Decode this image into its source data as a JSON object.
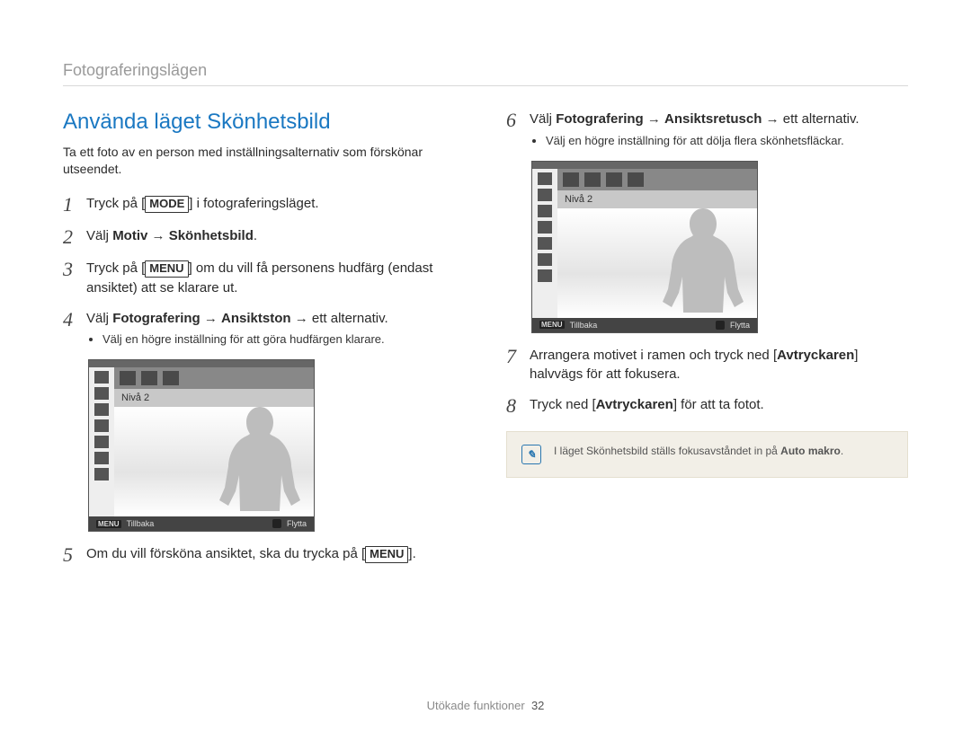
{
  "section_label": "Fotograferingslägen",
  "title": "Använda läget Skönhetsbild",
  "intro": "Ta ett foto av en person med inställningsalternativ som förskönar utseendet.",
  "keys": {
    "mode": "MODE",
    "menu": "MENU"
  },
  "steps_left": {
    "s1_a": "Tryck på [",
    "s1_b": "] i fotograferingsläget.",
    "s2_a": "Välj ",
    "s2_b": "Motiv",
    "s2_c": "Skönhetsbild",
    "s2_d": ".",
    "s3_a": "Tryck på [",
    "s3_b": "] om du vill få personens hudfärg (endast ansiktet) att se klarare ut.",
    "s4_a": "Välj ",
    "s4_b": "Fotografering",
    "s4_c": "Ansiktston",
    "s4_d": " → ett alternativ.",
    "s4_sub": "Välj en högre inställning för att göra hudfärgen klarare.",
    "s5_a": "Om du vill försköna ansiktet, ska du trycka på [",
    "s5_b": "]."
  },
  "steps_right": {
    "s6_a": "Välj ",
    "s6_b": "Fotografering",
    "s6_c": "Ansiktsretusch",
    "s6_d": " → ett alternativ.",
    "s6_sub": "Välj en högre inställning för att dölja flera skönhetsfläckar.",
    "s7_a": "Arrangera motivet i ramen och tryck ned [",
    "s7_b": "Avtryckaren",
    "s7_c": "] halvvägs för att fokusera.",
    "s8_a": "Tryck ned [",
    "s8_b": "Avtryckaren",
    "s8_c": "] för att ta fotot."
  },
  "step_numbers": {
    "n1": "1",
    "n2": "2",
    "n3": "3",
    "n4": "4",
    "n5": "5",
    "n6": "6",
    "n7": "7",
    "n8": "8"
  },
  "screenshot": {
    "level_label": "Nivå 2",
    "footer_menu": "MENU",
    "footer_back": "Tillbaka",
    "footer_move": "Flytta"
  },
  "note": {
    "text_a": "I läget Skönhetsbild ställs fokusavståndet in på ",
    "text_b": "Auto makro",
    "text_c": "."
  },
  "footer": {
    "label": "Utökade funktioner",
    "page": "32"
  },
  "arrow": "→"
}
